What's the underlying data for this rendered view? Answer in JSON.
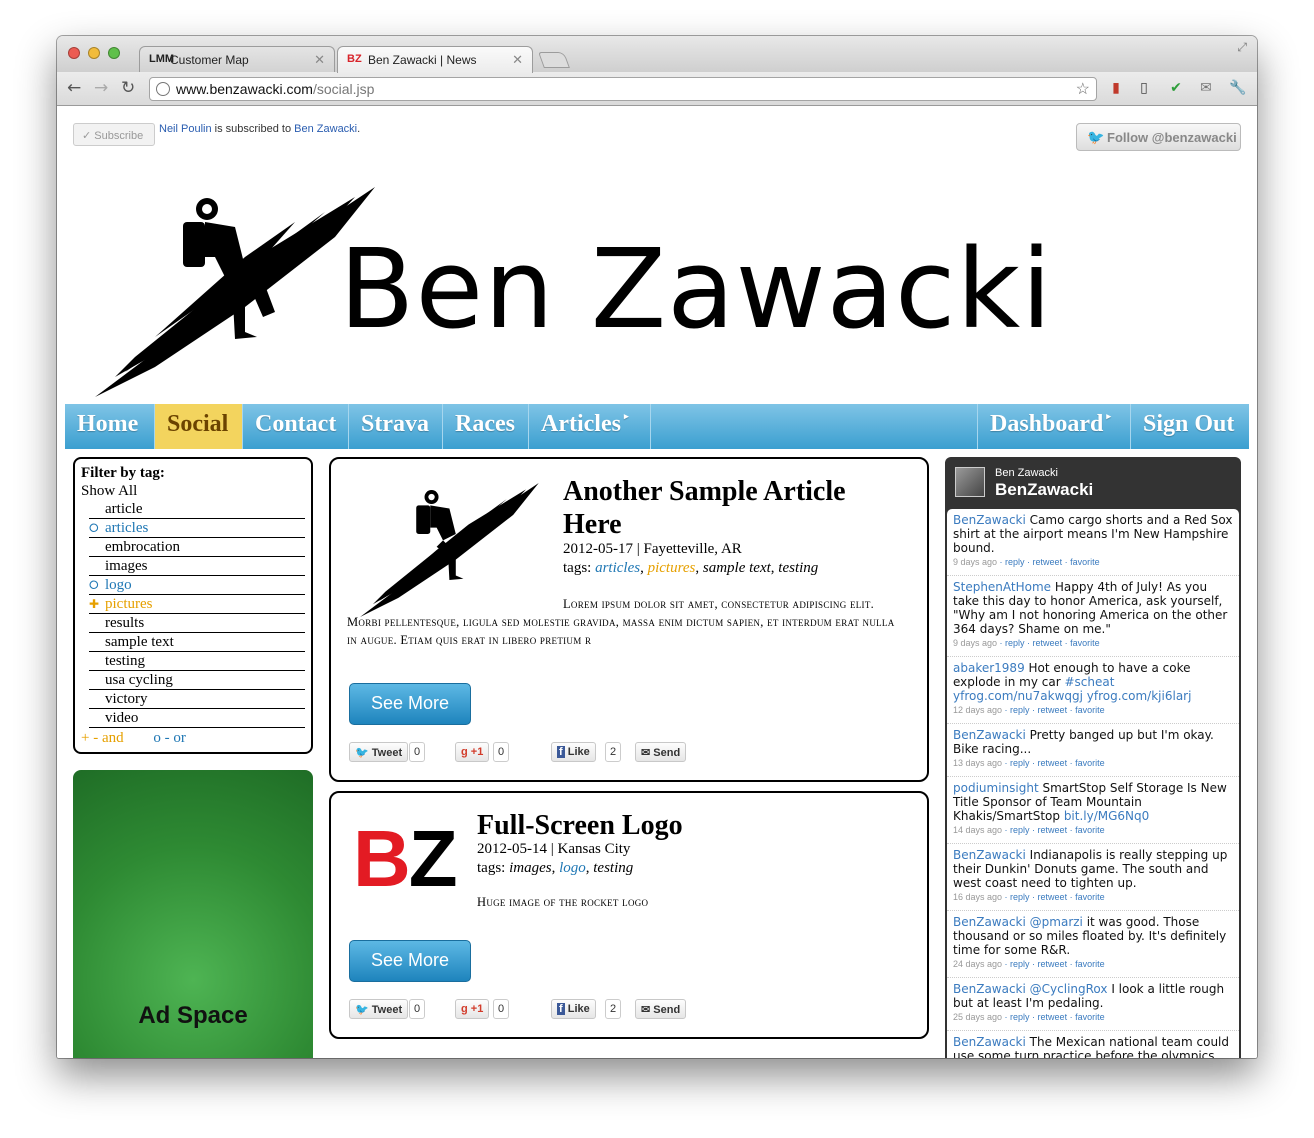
{
  "browser": {
    "tabs": [
      {
        "label": "Customer Map",
        "favicon": "LMM"
      },
      {
        "label": "Ben Zawacki | News",
        "favicon": "BZ"
      }
    ],
    "url_host": "www.benzawacki.com",
    "url_path": "/social.jsp"
  },
  "header": {
    "subscribe_label": "Subscribe",
    "subscriber_name": "Neil Poulin",
    "subscribed_text": "is subscribed to",
    "subscribed_to": "Ben Zawacki",
    "follow_label": "Follow @benzawacki",
    "site_name": "Ben Zawacki"
  },
  "nav": {
    "items": [
      "Home",
      "Social",
      "Contact",
      "Strava",
      "Races",
      "Articles",
      "Dashboard",
      "Sign Out"
    ],
    "active": "Social"
  },
  "filter": {
    "title": "Filter by tag:",
    "show_all": "Show All",
    "tags": [
      {
        "label": "article",
        "state": "none"
      },
      {
        "label": "articles",
        "state": "or"
      },
      {
        "label": "embrocation",
        "state": "none"
      },
      {
        "label": "images",
        "state": "none"
      },
      {
        "label": "logo",
        "state": "or"
      },
      {
        "label": "pictures",
        "state": "and"
      },
      {
        "label": "results",
        "state": "none"
      },
      {
        "label": "sample text",
        "state": "none"
      },
      {
        "label": "testing",
        "state": "none"
      },
      {
        "label": "usa cycling",
        "state": "none"
      },
      {
        "label": "victory",
        "state": "none"
      },
      {
        "label": "video",
        "state": "none"
      }
    ],
    "legend_and": "+ - and",
    "legend_or": "o - or"
  },
  "ad": {
    "label": "Ad Space"
  },
  "posts": [
    {
      "title": "Another Sample Article Here",
      "date_place": "2012-05-17 | Fayetteville, AR",
      "tags_prefix": "tags: ",
      "tag1": "articles",
      "tag2": "pictures",
      "tag3": "sample text",
      "tag4": "testing",
      "excerpt": "Lorem ipsum dolor sit amet, consectetur adipiscing elit. Morbi pellentesque, ligula sed molestie gravida, massa enim dictum sapien, et interdum erat nulla in augue. Etiam quis erat in libero pretium r",
      "see_more": "See More",
      "tweet_label": "Tweet",
      "tweet_count": "0",
      "plus_label": "+1",
      "plus_count": "0",
      "like_label": "Like",
      "like_count": "2",
      "send_label": "Send"
    },
    {
      "title": "Full-Screen Logo",
      "date_place": "2012-05-14 | Kansas City",
      "tags_prefix": "tags: ",
      "tag1": "images",
      "tag2": "logo",
      "tag3": "testing",
      "excerpt": "Huge image of the rocket logo",
      "see_more": "See More",
      "tweet_label": "Tweet",
      "tweet_count": "0",
      "plus_label": "+1",
      "plus_count": "0",
      "like_label": "Like",
      "like_count": "2",
      "send_label": "Send",
      "logo_b": "B",
      "logo_z": "Z"
    }
  ],
  "twitter": {
    "name": "Ben Zawacki",
    "handle": "BenZawacki",
    "actions": "reply · retweet · favorite",
    "tweets": [
      {
        "user": "BenZawacki",
        "text": " Camo cargo shorts and a Red Sox shirt at the airport means I'm New Hampshire bound.",
        "time": "9 days ago"
      },
      {
        "user": "StephenAtHome",
        "text": " Happy 4th of July! As you take this day to honor America, ask yourself, \"Why am I not honoring America on the other 364 days? Shame on me.\"",
        "time": "9 days ago"
      },
      {
        "user": "abaker1989",
        "text": " Hot enough to have a coke explode in my car ",
        "link": "#scheat yfrog.com/nu7akwqgj yfrog.com/kji6larj",
        "time": "12 days ago"
      },
      {
        "user": "BenZawacki",
        "text": " Pretty banged up but I'm okay. Bike racing...",
        "time": "13 days ago"
      },
      {
        "user": "podiuminsight",
        "text": " SmartStop Self Storage Is New Title Sponsor of Team Mountain Khakis/SmartStop ",
        "link": "bit.ly/MG6Nq0",
        "time": "14 days ago"
      },
      {
        "user": "BenZawacki",
        "text": " Indianapolis is really stepping up their Dunkin' Donuts game. The south and west coast need to tighten up.",
        "time": "16 days ago"
      },
      {
        "user": "BenZawacki @pmarzi",
        "text": " it was good. Those thousand or so miles floated by. It's definitely time for some R&R.",
        "time": "24 days ago"
      },
      {
        "user": "BenZawacki @CyclingRox",
        "text": " I look a little rough but at least I'm pedaling.",
        "time": "25 days ago"
      },
      {
        "user": "BenZawacki",
        "text": " The Mexican national team could use some turn practice before the olympics.",
        "time": ""
      }
    ]
  }
}
